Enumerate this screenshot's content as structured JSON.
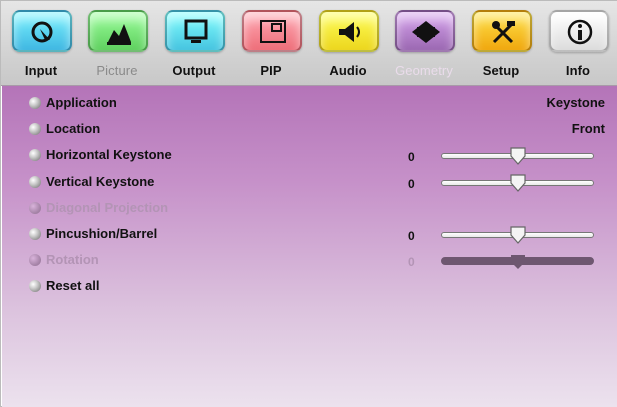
{
  "tabs": [
    {
      "label": "Input",
      "icon": "input-cursor-icon",
      "color": "#3fb7e2",
      "state": "normal"
    },
    {
      "label": "Picture",
      "icon": "picture-mountain-icon",
      "color": "#5fd05f",
      "state": "dim"
    },
    {
      "label": "Output",
      "icon": "monitor-icon",
      "color": "#46c4e0",
      "state": "normal"
    },
    {
      "label": "PIP",
      "icon": "pip-window-icon",
      "color": "#ee6e79",
      "state": "normal"
    },
    {
      "label": "Audio",
      "icon": "speaker-icon",
      "color": "#ecd61d",
      "state": "normal"
    },
    {
      "label": "Geometry",
      "icon": "geometry-shape-icon",
      "color": "#9b68b2",
      "state": "active"
    },
    {
      "label": "Setup",
      "icon": "tools-icon",
      "color": "#f0a70e",
      "state": "normal"
    },
    {
      "label": "Info",
      "icon": "info-icon",
      "color": "#dcdcdc",
      "state": "normal"
    }
  ],
  "menu": [
    {
      "label": "Application",
      "value": "Keystone",
      "type": "select",
      "enabled": true
    },
    {
      "label": "Location",
      "value": "Front",
      "type": "select",
      "enabled": true
    },
    {
      "label": "Horizontal Keystone",
      "value": "0",
      "type": "slider",
      "level": 0.5,
      "enabled": true
    },
    {
      "label": "Vertical Keystone",
      "value": "0",
      "type": "slider",
      "level": 0.5,
      "enabled": true
    },
    {
      "label": "Diagonal Projection",
      "value": "",
      "type": "none",
      "enabled": false
    },
    {
      "label": "Pincushion/Barrel",
      "value": "0",
      "type": "slider",
      "level": 0.5,
      "enabled": true
    },
    {
      "label": "Rotation",
      "value": "0",
      "type": "slider",
      "level": 0.5,
      "enabled": false
    },
    {
      "label": "Reset all",
      "value": "",
      "type": "action",
      "enabled": true
    }
  ],
  "colors": {
    "panel_top": "#b474b8",
    "panel_bottom": "#ece2ee",
    "active_tab_text": "#eadceb"
  }
}
